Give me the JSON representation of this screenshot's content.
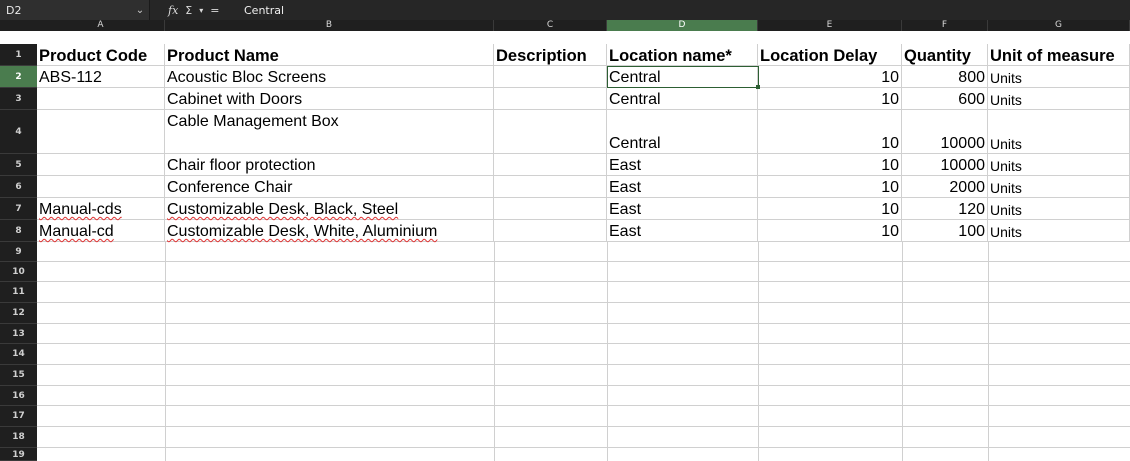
{
  "formula_bar": {
    "cell_ref": "D2",
    "icons": [
      "chevron-down-icon",
      "function-wizard-icon",
      "sum-icon",
      "dropdown-icon",
      "equals-icon"
    ],
    "fx_label": "fx",
    "sum_label": "Σ",
    "dropdown_label": "▾",
    "equals_label": "=",
    "content": "Central"
  },
  "columns": [
    "A",
    "B",
    "C",
    "D",
    "E",
    "F",
    "G"
  ],
  "selected_column": "D",
  "selected_row": "2",
  "rows": [
    "1",
    "2",
    "3",
    "4",
    "5",
    "6",
    "7",
    "8",
    "9",
    "10",
    "11",
    "12",
    "13",
    "14",
    "15",
    "16",
    "17",
    "18",
    "19"
  ],
  "header": {
    "a": "Product Code",
    "b": "Product Name",
    "c": "Description",
    "d": "Location name*",
    "e": "Location Delay",
    "f": "Quantity",
    "g": "Unit of measure"
  },
  "data": [
    {
      "a": "ABS-112",
      "b": "Acoustic Bloc Screens",
      "c": "",
      "d": "Central",
      "e": "10",
      "f": "800",
      "g": "Units"
    },
    {
      "a": "",
      "b": "Cabinet with Doors",
      "c": "",
      "d": "Central",
      "e": "10",
      "f": "600",
      "g": "Units"
    },
    {
      "a": "",
      "b": "Cable Management Box",
      "c": "",
      "d": "Central",
      "e": "10",
      "f": "10000",
      "g": "Units"
    },
    {
      "a": "",
      "b": "Chair floor protection",
      "c": "",
      "d": "East",
      "e": "10",
      "f": "10000",
      "g": "Units"
    },
    {
      "a": "",
      "b": "Conference Chair",
      "c": "",
      "d": "East",
      "e": "10",
      "f": "2000",
      "g": "Units"
    },
    {
      "a": "Manual-cds",
      "b": "Customizable Desk, Black, Steel",
      "c": "",
      "d": "East",
      "e": "10",
      "f": "120",
      "g": "Units"
    },
    {
      "a": "Manual-cd",
      "b": "Customizable Desk, White, Aluminium",
      "c": "",
      "d": "East",
      "e": "10",
      "f": "100",
      "g": "Units"
    }
  ],
  "colors": {
    "selection": "#2d5f33",
    "header_selected": "#4a7c4e",
    "chrome_dark": "#1f1f1f",
    "spellcheck": "#e03030"
  }
}
